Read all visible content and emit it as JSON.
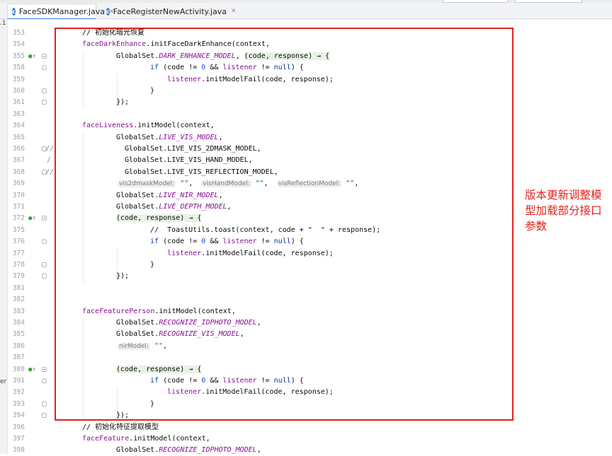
{
  "tabs": [
    {
      "label": "FaceSDKManager.java",
      "active": true
    },
    {
      "label": "FaceRegisterNewActivity.java",
      "active": false
    }
  ],
  "left_edge": {
    "top_text": ".1",
    "side_text": "er"
  },
  "annotation": {
    "text": "版本更新调整模型加载部分接口参数",
    "color": "#e2211c"
  },
  "lines": [
    {
      "n": "353",
      "text": "// 初始化暗光恢复"
    },
    {
      "n": "354",
      "text": "faceDarkEnhance.initFaceDarkEnhance(context,"
    },
    {
      "n": "355",
      "text": "GlobalSet.DARK_ENHANCE_MODEL, (code, response) → {"
    },
    {
      "n": "358",
      "text": "if (code != 0 && listener != null) {"
    },
    {
      "n": "359",
      "text": "listener.initModelFail(code, response);"
    },
    {
      "n": "360",
      "text": "}"
    },
    {
      "n": "361",
      "text": "});"
    },
    {
      "n": "363",
      "text": ""
    },
    {
      "n": "364",
      "text": "faceLiveness.initModel(context,"
    },
    {
      "n": "365",
      "text": "GlobalSet.LIVE_VIS_MODEL,"
    },
    {
      "n": "366",
      "text": "GlobalSet.LIVE_VIS_2DMASK_MODEL,"
    },
    {
      "n": "367",
      "text": "GlobalSet.LIVE_VIS_HAND_MODEL,"
    },
    {
      "n": "368",
      "text": "GlobalSet.LIVE_VIS_REFLECTION_MODEL,"
    },
    {
      "n": "369",
      "text": "vis2dmaskModel: \"\",  visHandModel: \"\",  visReflectionModel: \"\","
    },
    {
      "n": "370",
      "text": "GlobalSet.LIVE_NIR_MODEL,"
    },
    {
      "n": "371",
      "text": "GlobalSet.LIVE_DEPTH_MODEL,"
    },
    {
      "n": "372",
      "text": "(code, response) → {"
    },
    {
      "n": "375",
      "text": "//  ToastUtils.toast(context, code + \"  \" + response);"
    },
    {
      "n": "376",
      "text": "if (code != 0 && listener != null) {"
    },
    {
      "n": "377",
      "text": "listener.initModelFail(code, response);"
    },
    {
      "n": "378",
      "text": "}"
    },
    {
      "n": "379",
      "text": "});"
    },
    {
      "n": "381",
      "text": ""
    },
    {
      "n": "382",
      "text": ""
    },
    {
      "n": "383",
      "text": "faceFeaturePerson.initModel(context,"
    },
    {
      "n": "384",
      "text": "GlobalSet.RECOGNIZE_IDPHOTO_MODEL,"
    },
    {
      "n": "385",
      "text": "GlobalSet.RECOGNIZE_VIS_MODEL,"
    },
    {
      "n": "386",
      "text": "nirModel: \"\","
    },
    {
      "n": "387",
      "text": ""
    },
    {
      "n": "388",
      "text": "(code, response) → {"
    },
    {
      "n": "391",
      "text": "if (code != 0 && listener != null) {"
    },
    {
      "n": "392",
      "text": "listener.initModelFail(code, response);"
    },
    {
      "n": "393",
      "text": "}"
    },
    {
      "n": "394",
      "text": "});"
    },
    {
      "n": "396",
      "text": "// 初始化特征提取模型"
    },
    {
      "n": "397",
      "text": "faceFeature.initModel(context,"
    },
    {
      "n": "398",
      "text": "GlobalSet.RECOGNIZE_IDPHOTO_MODEL,"
    }
  ]
}
